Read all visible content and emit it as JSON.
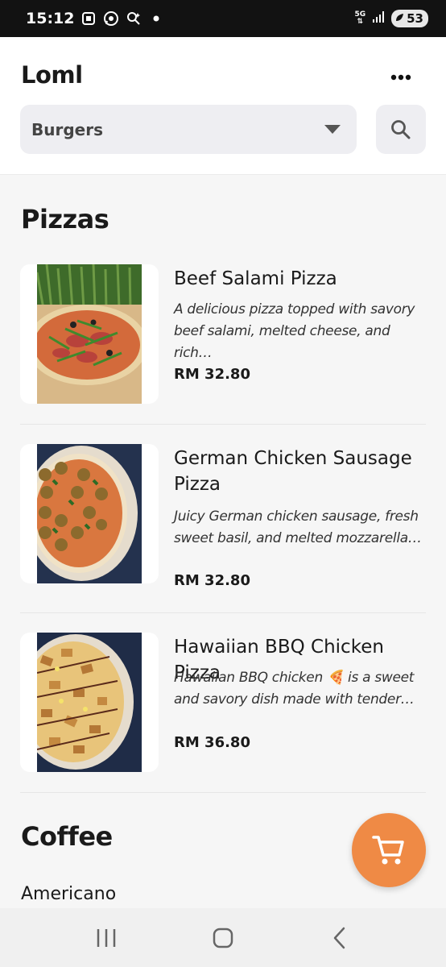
{
  "status_bar": {
    "time": "15:12",
    "icons": [
      "screenshot-icon",
      "whatsapp-icon",
      "assistant-icon",
      "dot-icon"
    ],
    "network_label": "5G",
    "battery_level": "53"
  },
  "header": {
    "brand": "Loml",
    "category_select": {
      "selected": "Burgers"
    }
  },
  "sections": [
    {
      "title": "Pizzas",
      "items": [
        {
          "name": "Beef Salami Pizza",
          "description": "A delicious pizza topped with savory beef salami, melted cheese, and rich…",
          "price": "RM 32.80"
        },
        {
          "name": "German Chicken Sausage Pizza",
          "description": "Juicy German chicken sausage, fresh sweet basil, and melted mozzarella…",
          "price": "RM 32.80"
        },
        {
          "name": "Hawaiian BBQ Chicken Pizza",
          "description": "Hawaiian BBQ chicken 🍕 is a sweet and savory dish made with tender…",
          "price": "RM 36.80"
        }
      ]
    },
    {
      "title": "Coffee",
      "items": [
        {
          "name": "Americano"
        }
      ]
    }
  ],
  "colors": {
    "accent": "#ef8a45",
    "status_bar": "#121212",
    "select_bg": "#eeeef2",
    "page_bg": "#f6f6f6"
  }
}
